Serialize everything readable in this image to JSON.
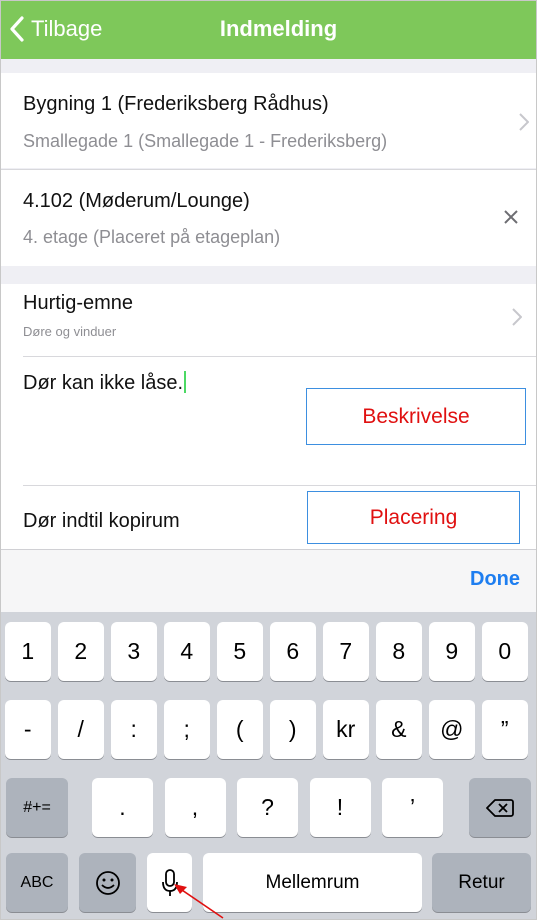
{
  "nav": {
    "back_label": "Tilbage",
    "title": "Indmelding"
  },
  "building": {
    "title": "Bygning 1 (Frederiksberg Rådhus)",
    "subtitle": "Smallegade 1 (Smallegade 1 - Frederiksberg)"
  },
  "room": {
    "title": "4.102  (Møderum/Lounge)",
    "subtitle": "4. etage (Placeret på etageplan)"
  },
  "quick_topic": {
    "title": "Hurtig-emne",
    "subtitle": "Døre og vinduer"
  },
  "description": {
    "text": "Dør kan ikke låse.",
    "annotation": "Beskrivelse"
  },
  "placement": {
    "text": "Dør indtil kopirum",
    "annotation": "Placering"
  },
  "accessory": {
    "done_label": "Done"
  },
  "keyboard": {
    "row1": [
      "1",
      "2",
      "3",
      "4",
      "5",
      "6",
      "7",
      "8",
      "9",
      "0"
    ],
    "row2": [
      "-",
      "/",
      ":",
      ";",
      "(",
      ")",
      "kr",
      "&",
      "@",
      "”"
    ],
    "row3_left": "#+=",
    "row3": [
      ".",
      ",",
      "?",
      "!",
      "’"
    ],
    "abc": "ABC",
    "space": "Mellemrum",
    "return": "Retur"
  },
  "colors": {
    "nav_green": "#7ec85a",
    "done_blue": "#1e7ef0",
    "annotation_red": "#e01010",
    "annotation_border": "#3d8fe0"
  }
}
